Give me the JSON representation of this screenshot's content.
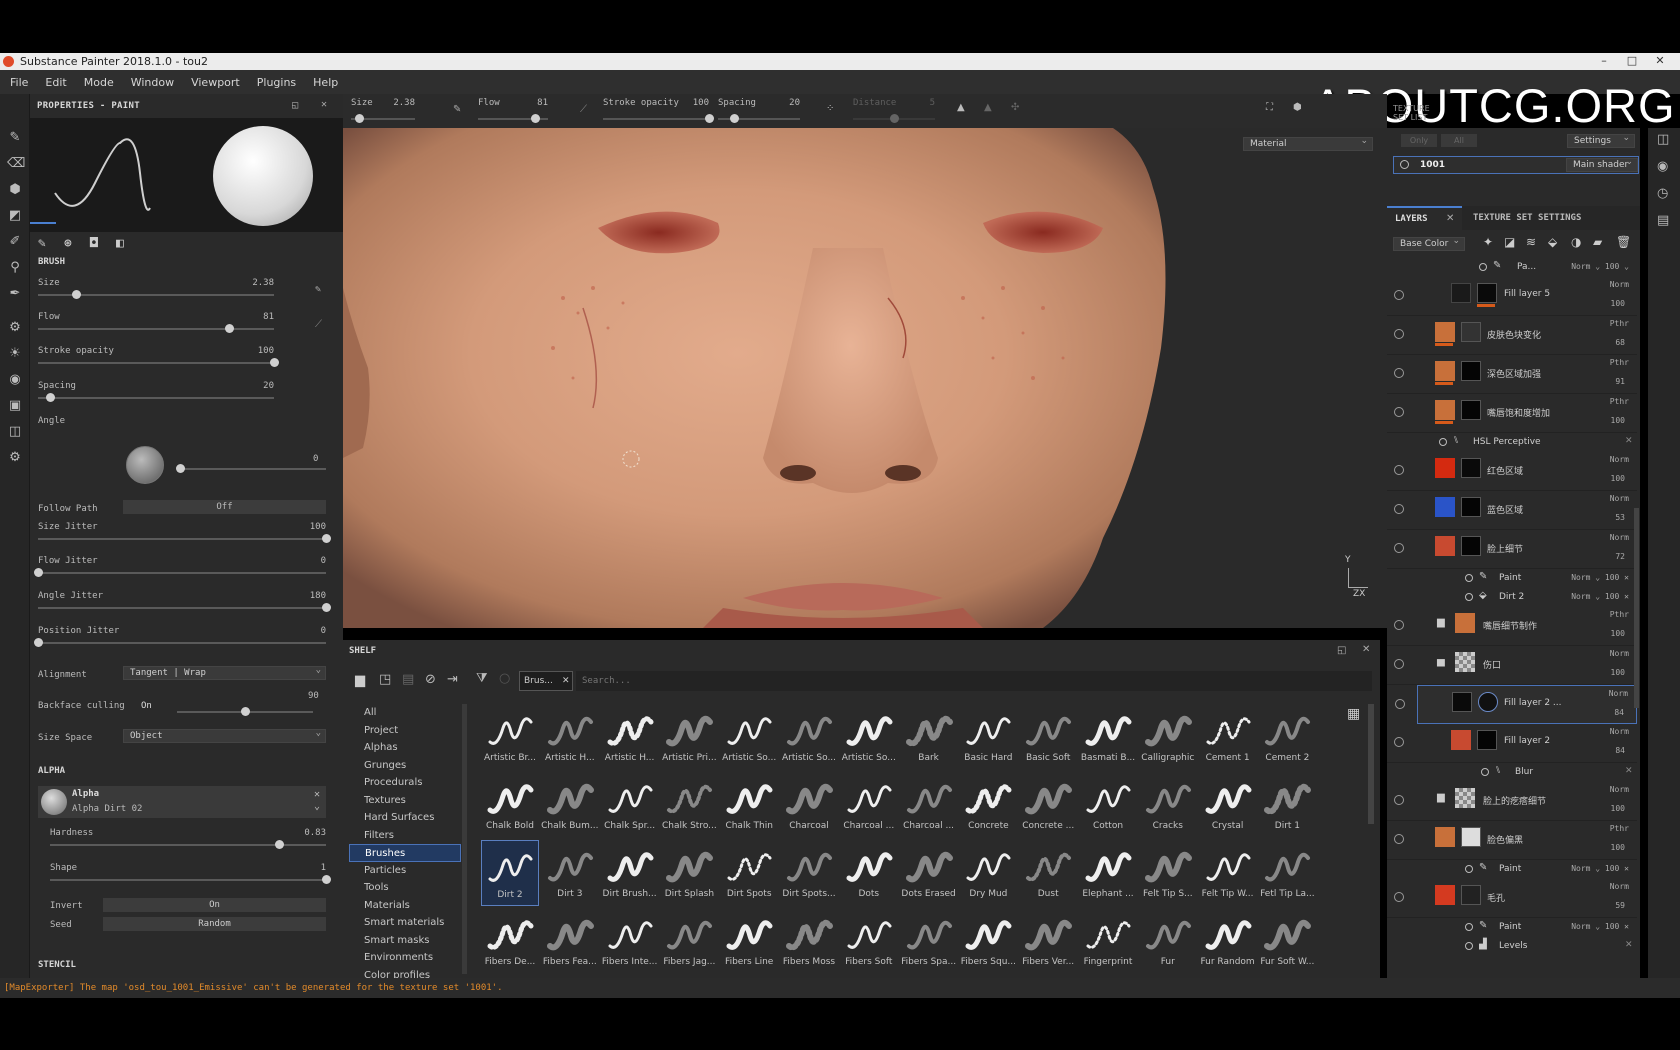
{
  "window": {
    "title": "Substance Painter 2018.1.0 - tou2"
  },
  "watermark": "ABOUTCG.ORG",
  "menu": [
    "File",
    "Edit",
    "Mode",
    "Window",
    "Viewport",
    "Plugins",
    "Help"
  ],
  "toolbar": {
    "size": {
      "label": "Size",
      "value": "2.38",
      "pos": 0.12
    },
    "flow": {
      "label": "Flow",
      "value": "81",
      "pos": 0.81
    },
    "stroke_opacity": {
      "label": "Stroke opacity",
      "value": "100",
      "pos": 1.0
    },
    "spacing": {
      "label": "Spacing",
      "value": "20",
      "pos": 0.2
    },
    "distance": {
      "label": "Distance",
      "value": "5",
      "pos": 0.5
    },
    "texture_set_list": "TEXTURE SET LIST"
  },
  "properties": {
    "header": "PROPERTIES - PAINT",
    "brush_section": "BRUSH",
    "size": {
      "label": "Size",
      "value": "2.38",
      "pos": 0.16
    },
    "flow": {
      "label": "Flow",
      "value": "81",
      "pos": 0.81
    },
    "stroke_opacity": {
      "label": "Stroke opacity",
      "value": "100",
      "pos": 1.0
    },
    "spacing": {
      "label": "Spacing",
      "value": "20",
      "pos": 0.05
    },
    "angle": {
      "label": "Angle",
      "value": "0"
    },
    "follow_path": {
      "label": "Follow Path",
      "value": "Off"
    },
    "size_jitter": {
      "label": "Size Jitter",
      "value": "100",
      "pos": 1.0
    },
    "flow_jitter": {
      "label": "Flow Jitter",
      "value": "0",
      "pos": 0.0
    },
    "angle_jitter": {
      "label": "Angle Jitter",
      "value": "180",
      "pos": 1.0
    },
    "position_jitter": {
      "label": "Position Jitter",
      "value": "0",
      "pos": 0.0
    },
    "alignment": {
      "label": "Alignment",
      "value": "Tangent | Wrap"
    },
    "backface_culling": {
      "label": "Backface culling",
      "toggle": "On",
      "value": "90",
      "pos": 0.5
    },
    "size_space": {
      "label": "Size Space",
      "value": "Object"
    },
    "alpha_section": "ALPHA",
    "alpha_title": "Alpha",
    "alpha_value": "Alpha Dirt 02",
    "hardness": {
      "label": "Hardness",
      "value": "0.83",
      "pos": 0.83
    },
    "shape": {
      "label": "Shape",
      "value": "1",
      "pos": 1.0
    },
    "invert": {
      "label": "Invert",
      "value": "On"
    },
    "seed": {
      "label": "Seed",
      "value": "Random"
    },
    "stencil_section": "STENCIL"
  },
  "viewport": {
    "mode": "Material",
    "axis_y": "Y",
    "axis_zx": "ZX"
  },
  "texture_set": {
    "tab_only": "Only",
    "tab_all": "All",
    "settings": "Settings",
    "item": "1001",
    "shader": "Main shader"
  },
  "layers_panel": {
    "tab_layers": "LAYERS",
    "tab_tss": "TEXTURE SET SETTINGS",
    "channel": "Base Color",
    "top_sub": {
      "name": "Pa...",
      "blend": "Norm",
      "opacity": "100"
    },
    "rows": [
      {
        "name": "Fill layer 5",
        "blend": "Norm",
        "opacity": "100",
        "color": "#222",
        "mask": "#111"
      },
      {
        "name": "皮肤色块变化",
        "blend": "Pthr",
        "opacity": "68",
        "color": "#c8703a",
        "mask": "#333"
      },
      {
        "name": "深色区域加强",
        "blend": "Pthr",
        "opacity": "91",
        "color": "#c8703a",
        "mask": "#050505"
      },
      {
        "name": "嘴唇饱和度增加",
        "blend": "Pthr",
        "opacity": "100",
        "color": "#c8703a",
        "mask": "#050505"
      }
    ],
    "hsl": "HSL Perceptive",
    "rows2": [
      {
        "name": "红色区域",
        "blend": "Norm",
        "opacity": "100",
        "color": "#d42a10",
        "mask": "#0a0a0a"
      },
      {
        "name": "蓝色区域",
        "blend": "Norm",
        "opacity": "53",
        "color": "#2a54c8",
        "mask": "#050505"
      },
      {
        "name": "脸上细节",
        "blend": "Norm",
        "opacity": "72",
        "color": "#c84a30",
        "mask": "#050505"
      }
    ],
    "sub_paint": {
      "name": "Paint",
      "blend": "Norm",
      "opacity": "100"
    },
    "sub_dirt": {
      "name": "Dirt 2",
      "blend": "Norm",
      "opacity": "100"
    },
    "folder1": {
      "name": "嘴唇细节制作",
      "blend": "Pthr",
      "opacity": "100"
    },
    "folder2": {
      "name": "伤口",
      "blend": "Norm",
      "opacity": "100"
    },
    "fill2a": {
      "name": "Fill layer 2 ...",
      "blend": "Norm",
      "opacity": "84"
    },
    "fill2b": {
      "name": "Fill layer 2",
      "blend": "Norm",
      "opacity": "84"
    },
    "blur": "Blur",
    "folder3": {
      "name": "脸上的疙瘩细节",
      "blend": "Norm",
      "opacity": "100"
    },
    "row_color": {
      "name": "脸色偏黑",
      "blend": "Pthr",
      "opacity": "100"
    },
    "sub_paint2": {
      "name": "Paint",
      "blend": "Norm",
      "opacity": "100"
    },
    "row_pores": {
      "name": "毛孔",
      "blend": "Norm",
      "opacity": "59"
    },
    "sub_paint3": {
      "name": "Paint",
      "blend": "Norm",
      "opacity": "100"
    },
    "levels": "Levels"
  },
  "shelf": {
    "title": "SHELF",
    "filter_tag": "Brus...",
    "search_placeholder": "Search...",
    "categories": [
      "All",
      "Project",
      "Alphas",
      "Grunges",
      "Procedurals",
      "Textures",
      "Hard Surfaces",
      "Filters",
      "Brushes",
      "Particles",
      "Tools",
      "Materials",
      "Smart materials",
      "Smart masks",
      "Environments",
      "Color profiles"
    ],
    "brushes": [
      "Artistic Br...",
      "Artistic H...",
      "Artistic H...",
      "Artistic Pri...",
      "Artistic So...",
      "Artistic So...",
      "Artistic So...",
      "Bark",
      "Basic Hard",
      "Basic Soft",
      "Basmati B...",
      "Calligraphic",
      "Cement 1",
      "Cement 2",
      "Chalk Bold",
      "Chalk Bum...",
      "Chalk Spr...",
      "Chalk Stro...",
      "Chalk Thin",
      "Charcoal",
      "Charcoal ...",
      "Charcoal ...",
      "Concrete",
      "Concrete ...",
      "Cotton",
      "Cracks",
      "Crystal",
      "Dirt 1",
      "Dirt 2",
      "Dirt 3",
      "Dirt Brush...",
      "Dirt Splash",
      "Dirt Spots",
      "Dirt Spots...",
      "Dots",
      "Dots Erased",
      "Dry Mud",
      "Dust",
      "Elephant ...",
      "Felt Tip S...",
      "Felt Tip W...",
      "Fetl Tip La...",
      "Fibers De...",
      "Fibers Fea...",
      "Fibers Inte...",
      "Fibers Jag...",
      "Fibers Line",
      "Fibers Moss",
      "Fibers Soft",
      "Fibers Spa...",
      "Fibers Squ...",
      "Fibers Ver...",
      "Fingerprint",
      "Fur",
      "Fur Random",
      "Fur Soft W..."
    ]
  },
  "status": "[MapExporter] The map 'osd_tou_1001_Emissive' can't be generated for the texture set '1001'."
}
